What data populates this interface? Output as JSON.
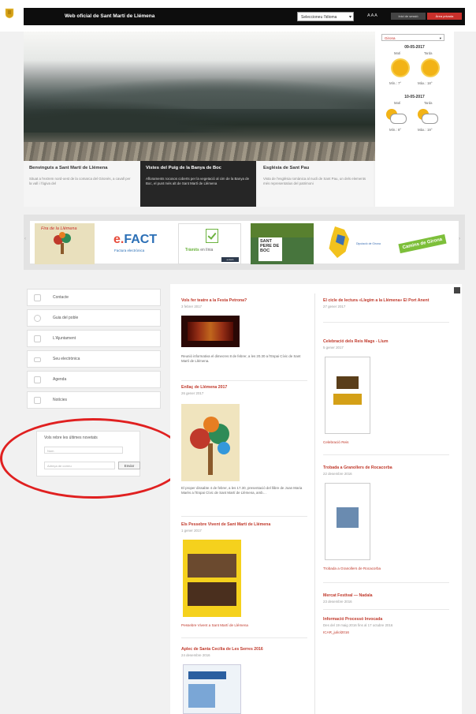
{
  "header": {
    "site_title": "Web oficial de Sant Martí de Llémena",
    "language_select": "Seleccioneu l'idioma",
    "font_size": "A A A",
    "login": "Inici de sessió",
    "admin": "Àrea privada"
  },
  "hero": {
    "captions": [
      {
        "title": "Benvinguts a Sant Martí de Llémena",
        "text": "Situat a l'extrem nord-oest de la comarca del Gironès, a cavall per la vall i l'ògiva del"
      },
      {
        "title": "Vistes del Puig de la Banya de Boc",
        "text": "Afloraments rocosos coberts per la vegetació al cim de la Banya de Boc, el punt més alt de Sant Martí de Llémena"
      },
      {
        "title": "Església de Sant Pau",
        "text": "Vista de l'església romànica al nucli de Sant Pau, un dels elements més representatius del patrimoni"
      }
    ]
  },
  "weather": {
    "select": "Girona",
    "days": [
      {
        "date": "09-05-2017",
        "labels": [
          "Matí",
          "Tarda"
        ],
        "temps": "Mín.: 7°",
        "temps2": "Màx.: 18°",
        "icons": [
          "sun-icon",
          "sun-icon"
        ]
      },
      {
        "date": "10-05-2017",
        "labels": [
          "Matí",
          "Tarda"
        ],
        "temps": "Mín.: 8°",
        "temps2": "Màx.: 19°",
        "icons": [
          "cloud-sun-icon",
          "cloud-sun-icon"
        ]
      }
    ]
  },
  "logos": {
    "fira": "Fira de la Llémena",
    "efact_main": "e.",
    "efact_fact": "FACT",
    "efact_sub": "Factura electrònica",
    "tramits": "Tràmits",
    "tramits_sub": "en línia",
    "tramits_flag": "e-tram",
    "sant_pere": "SANT PERE DE BOC",
    "ddgi": "Diputació de Girona",
    "calb": "Camins de Girona"
  },
  "nav": [
    {
      "label": "Contacte",
      "icon": "phone-icon"
    },
    {
      "label": "Guia del poble",
      "icon": "map-pin-icon"
    },
    {
      "label": "L'Ajuntament",
      "icon": "building-icon"
    },
    {
      "label": "Seu electrònica",
      "icon": "monitor-icon"
    },
    {
      "label": "Agenda",
      "icon": "calendar-icon"
    },
    {
      "label": "Notícies",
      "icon": "newspaper-icon"
    }
  ],
  "newsletter": {
    "title": "Vols rebre les últimes novetats",
    "name_placeholder": "Nom",
    "email_placeholder": "Adreça de correu",
    "submit": "Enviar"
  },
  "articles_left": [
    {
      "title": "Vols fer teatre a la Festa Petrona?",
      "date": "3 febrer 2017",
      "text": "Reunió informativa el dimecres 8 de febrer, a les 20.30 a l'Espai Cívic de Sant Martí de Llémena."
    },
    {
      "title": "Enllaç de Llémena 2017",
      "date": "26 gener 2017",
      "text": "El proper dissabte 4 de febrer, a les 17.30, presentació del llibre de Joan Maria Marès a l'Espai Cívic de Sant Martí de Llémena, amb…"
    },
    {
      "title": "Els Pessebre Vivent de Sant Martí de Llémena",
      "date": "1 gener 2017",
      "text": "Pessebre Vivent a Sant Martí de Llémena"
    },
    {
      "title": "Aplec de Santa Cecília de Les Serres 2016",
      "date": "24 desembre 2016",
      "text": ""
    }
  ],
  "articles_right": [
    {
      "title": "El cicle de lectura «Llegim a la Llémena» El Port Anent",
      "date": "27 gener 2017",
      "text": ""
    },
    {
      "title": "Celebració dels Reis Mags - Llum",
      "date": "5 gener 2017",
      "text": "Celebració Reis"
    },
    {
      "title": "Trobada a Granollers de Rocacorba",
      "date": "22 desembre 2016",
      "text": "Trobada a Granollers de Rocacorba"
    },
    {
      "title": "Mercat Festival — Nadala",
      "date": "23 desembre 2016",
      "text": ""
    },
    {
      "title": "Informació Processó Invocada",
      "date": "Des del 19 maig 2016 fins al 17 octubre 2016",
      "text": "ICAR_juliol2016"
    }
  ],
  "colors": {
    "accent": "#c8302b",
    "topbar": "#0d0d0d",
    "panel": "#262626"
  }
}
